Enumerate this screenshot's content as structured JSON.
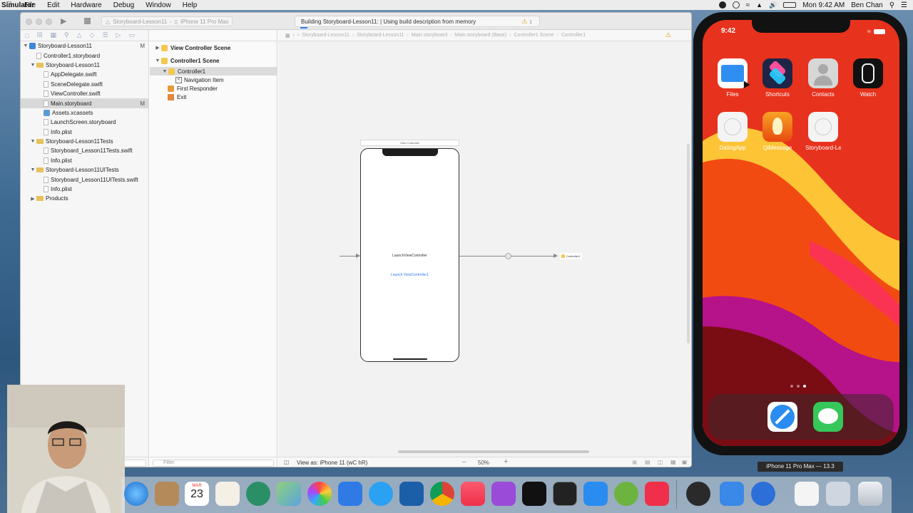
{
  "menubar": {
    "app_name": "Simulator",
    "menus": [
      "File",
      "Edit",
      "Hardware",
      "Debug",
      "Window",
      "Help"
    ],
    "clock": "Mon 9:42 AM",
    "user": "Ben Chan"
  },
  "xcode": {
    "scheme": "Storyboard-Lesson11",
    "destination": "iPhone 11 Pro Max",
    "activity_text": "Building Storyboard-Lesson11: | Using build description from memory",
    "warning_count": "1",
    "jumpbar": [
      "Storyboard-Lesson11",
      "Storyboard-Lesson11",
      "Main.storyboard",
      "Main.storyboard (Base)",
      "Controller1 Scene",
      "Controller1"
    ],
    "navigator": [
      {
        "label": "Storyboard-Lesson11",
        "kind": "project",
        "depth": 0,
        "badge": "M"
      },
      {
        "label": "Controller1.storyboard",
        "kind": "file",
        "depth": 1,
        "badge": ""
      },
      {
        "label": "Storyboard-Lesson11",
        "kind": "folder",
        "depth": 1,
        "badge": ""
      },
      {
        "label": "AppDelegate.swift",
        "kind": "file",
        "depth": 2,
        "badge": ""
      },
      {
        "label": "SceneDelegate.swift",
        "kind": "file",
        "depth": 2,
        "badge": ""
      },
      {
        "label": "ViewController.swift",
        "kind": "file",
        "depth": 2,
        "badge": ""
      },
      {
        "label": "Main.storyboard",
        "kind": "file",
        "depth": 2,
        "badge": "M"
      },
      {
        "label": "Assets.xcassets",
        "kind": "asset",
        "depth": 2,
        "badge": ""
      },
      {
        "label": "LaunchScreen.storyboard",
        "kind": "file",
        "depth": 2,
        "badge": ""
      },
      {
        "label": "Info.plist",
        "kind": "file",
        "depth": 2,
        "badge": ""
      },
      {
        "label": "Storyboard-Lesson11Tests",
        "kind": "folder",
        "depth": 1,
        "badge": ""
      },
      {
        "label": "Storyboard_Lesson11Tests.swift",
        "kind": "file",
        "depth": 2,
        "badge": ""
      },
      {
        "label": "Info.plist",
        "kind": "file",
        "depth": 2,
        "badge": ""
      },
      {
        "label": "Storyboard-Lesson11UITests",
        "kind": "folder",
        "depth": 1,
        "badge": ""
      },
      {
        "label": "Storyboard_Lesson11UITests.swift",
        "kind": "file",
        "depth": 2,
        "badge": ""
      },
      {
        "label": "Info.plist",
        "kind": "file",
        "depth": 2,
        "badge": ""
      },
      {
        "label": "Products",
        "kind": "folder",
        "depth": 1,
        "badge": ""
      }
    ],
    "outline": {
      "scene1": "View Controller Scene",
      "scene2": "Controller1 Scene",
      "controller": "Controller1",
      "nav_item": "Navigation Item",
      "first_responder": "First Responder",
      "exit": "Exit",
      "filter_placeholder": "Filter"
    },
    "canvas": {
      "scene_title": "View Controller",
      "vc_label": "LaunchViewController",
      "vc_button": "Launch ViewController1",
      "segue_target": "Controller1"
    },
    "bottom": {
      "view_as": "View as: iPhone 11 (wC hR)",
      "zoom": "50%"
    }
  },
  "simulator": {
    "time": "9:42",
    "apps": [
      {
        "label": "Files",
        "color": "#2f8ff0"
      },
      {
        "label": "Shortcuts",
        "color": "#3b3bb0"
      },
      {
        "label": "Contacts",
        "color": "#c9c9c9"
      },
      {
        "label": "Watch",
        "color": "#111111"
      },
      {
        "label": "DatingApp",
        "color": "#f4f4f4"
      },
      {
        "label": "QiMessage",
        "color": "#f07b12"
      },
      {
        "label": "Storyboard-Les...",
        "color": "#f4f4f4"
      }
    ],
    "dock_apps": [
      {
        "name": "safari-icon",
        "color": "#2a8cf0"
      },
      {
        "name": "messages-icon",
        "color": "#35c759"
      }
    ],
    "tooltip": "iPhone 11 Pro Max — 13.3"
  },
  "dock": {
    "calendar_month": "MAR",
    "calendar_day": "23"
  }
}
